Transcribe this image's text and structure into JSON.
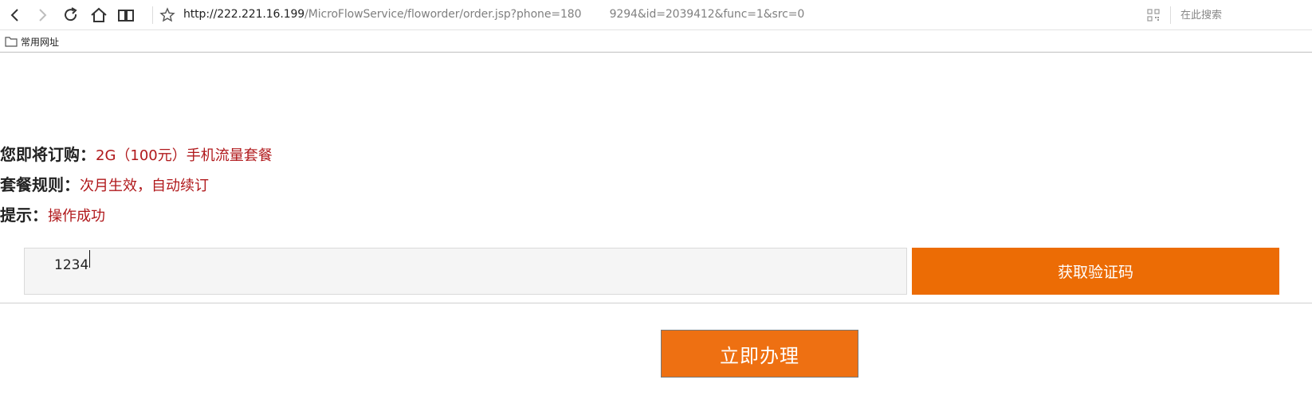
{
  "browser": {
    "url_host": "http://222.221.16.199",
    "url_path": "/MicroFlowService/floworder/order.jsp?phone=180    9294&id=2039412&func=1&src=0",
    "search_placeholder": "在此搜索",
    "bookmark_label": "常用网址",
    "icons": [
      "back-icon",
      "forward-icon",
      "reload-icon",
      "home-icon",
      "reader-icon",
      "star-icon",
      "qr-code-icon",
      "folder-icon"
    ]
  },
  "order": {
    "product_label": "您即将订购：",
    "product_value": "2G（100元）手机流量套餐",
    "rule_label": "套餐规则：",
    "rule_value": "次月生效，自动续订",
    "tip_label": "提示：",
    "tip_value": "操作成功"
  },
  "form": {
    "code_value": "1234",
    "get_code_label": "获取验证码",
    "submit_label": "立即办理"
  },
  "footer": {
    "clipped_text": "……………………"
  },
  "colors": {
    "accent_orange": "#ec6c05",
    "value_red": "#b0181b"
  }
}
